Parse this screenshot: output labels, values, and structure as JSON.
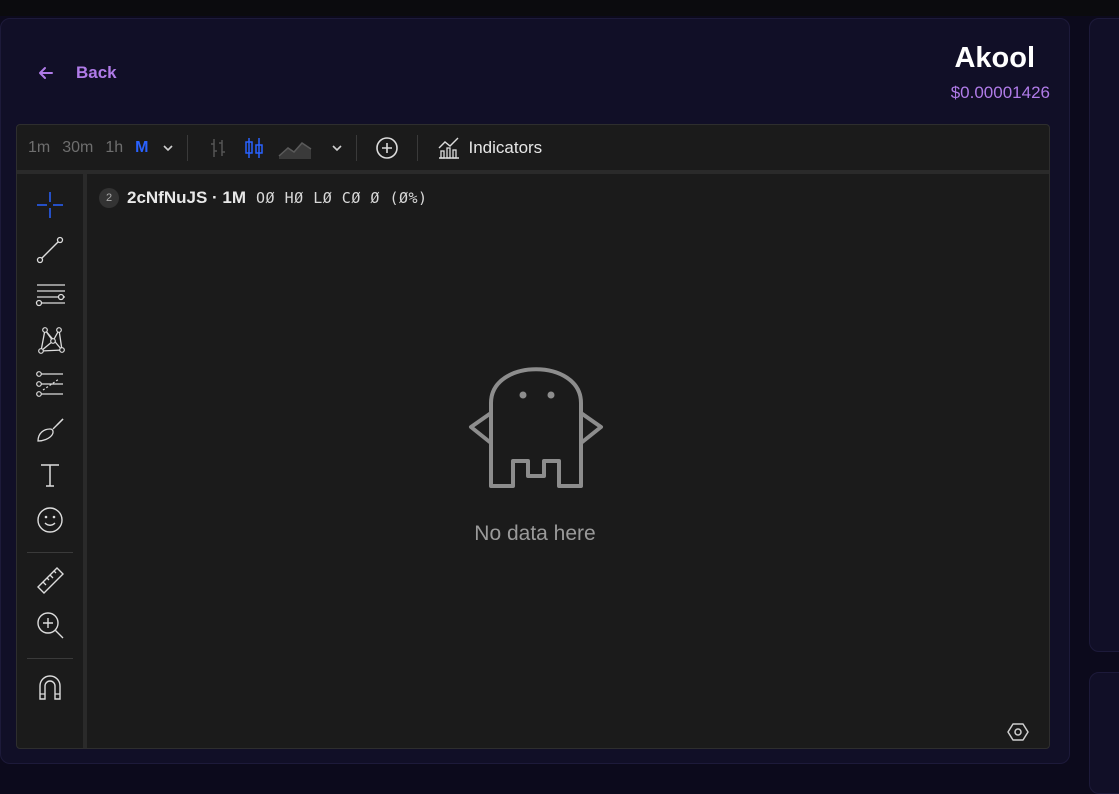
{
  "header": {
    "back_label": "Back",
    "token_name": "Akool",
    "token_price": "$0.00001426"
  },
  "toolbar": {
    "timeframes": [
      "1m",
      "30m",
      "1h",
      "M"
    ],
    "active_timeframe": "M",
    "indicators_label": "Indicators"
  },
  "legend": {
    "badge": "2",
    "symbol": "2cNfNuJS · 1M",
    "ohlc": "OØ HØ LØ CØ Ø (Ø%)"
  },
  "chart": {
    "empty_message": "No data here"
  },
  "colors": {
    "accent": "#b07be8",
    "active_timeframe": "#2962ff",
    "panel_bg": "#110f27",
    "chart_bg": "#1b1b1b"
  },
  "left_tools": [
    "crosshair-icon",
    "trend-line-icon",
    "fib-retracement-icon",
    "pattern-icon",
    "prediction-icon",
    "brush-icon",
    "text-icon",
    "emoji-icon",
    "ruler-icon",
    "zoom-in-icon",
    "magnet-icon"
  ]
}
